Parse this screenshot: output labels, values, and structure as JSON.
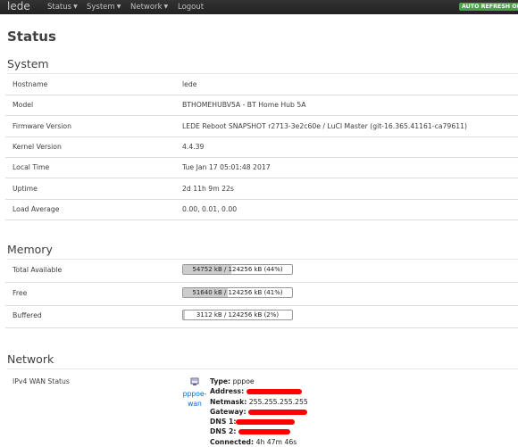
{
  "navbar": {
    "brand": "lede",
    "menus": [
      "Status",
      "System",
      "Network",
      "Logout"
    ],
    "autorefresh": "AUTO REFRESH ON"
  },
  "page_title": "Status",
  "system": {
    "heading": "System",
    "rows": [
      {
        "key": "Hostname",
        "value": "lede"
      },
      {
        "key": "Model",
        "value": "BTHOMEHUBV5A - BT Home Hub 5A"
      },
      {
        "key": "Firmware Version",
        "value": "LEDE Reboot SNAPSHOT r2713-3e2c60e / LuCI Master (git-16.365.41161-ca79611)"
      },
      {
        "key": "Kernel Version",
        "value": "4.4.39"
      },
      {
        "key": "Local Time",
        "value": "Tue Jan 17 05:01:48 2017"
      },
      {
        "key": "Uptime",
        "value": "2d 11h 9m 22s"
      },
      {
        "key": "Load Average",
        "value": "0.00, 0.01, 0.00"
      }
    ]
  },
  "memory": {
    "heading": "Memory",
    "rows": [
      {
        "key": "Total Available",
        "text": "54752 kB / 124256 kB (44%)",
        "percent": 44
      },
      {
        "key": "Free",
        "text": "51640 kB / 124256 kB (41%)",
        "percent": 41
      },
      {
        "key": "Buffered",
        "text": "3112 kB / 124256 kB (2%)",
        "percent": 2
      }
    ]
  },
  "network": {
    "heading": "Network",
    "ipv4_label": "IPv4 WAN Status",
    "iface_name": "pppoe-wan",
    "type_label": "Type:",
    "type_value": "pppoe",
    "address_label": "Address:",
    "netmask_label": "Netmask:",
    "netmask_value": "255.255.255.255",
    "gateway_label": "Gateway:",
    "dns1_label": "DNS 1:",
    "dns2_label": "DNS 2:",
    "connected_label": "Connected:",
    "connected_value": "4h 47m 46s"
  },
  "colors": {
    "accent_link": "#0069d6",
    "autorefresh_bg": "#46a546",
    "redaction": "#ff0000"
  }
}
